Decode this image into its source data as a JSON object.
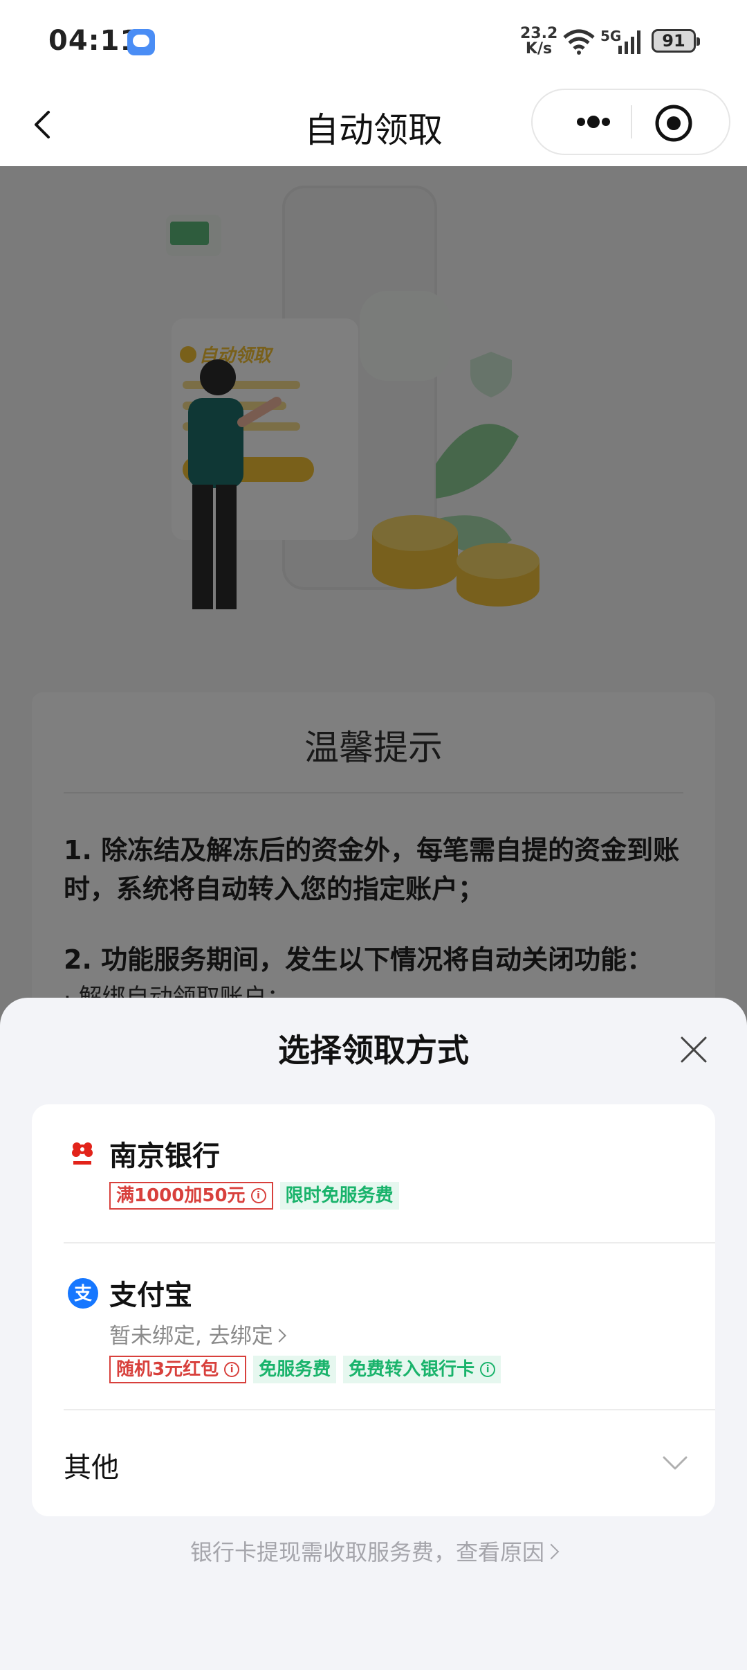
{
  "status_bar": {
    "time": "04:11",
    "net_speed_value": "23.2",
    "net_speed_unit": "K/s",
    "signal_label": "5G",
    "battery": "91"
  },
  "nav": {
    "title": "自动领取"
  },
  "hero": {
    "card_text": "自动领取"
  },
  "tips": {
    "title": "温馨提示",
    "item1": "1. 除冻结及解冻后的资金外，每笔需自提的资金到账时，系统将自动转入您的指定账户；",
    "item2": "2. 功能服务期间，发生以下情况将自动关闭功能：",
    "item2_sub": "· 解绑自动领取账户；"
  },
  "sheet": {
    "title": "选择领取方式",
    "options": [
      {
        "name": "南京银行",
        "tags": [
          "满1000加50元",
          "限时免服务费"
        ]
      },
      {
        "name": "支付宝",
        "subtitle": "暂未绑定, 去绑定",
        "tags": [
          "随机3元红包",
          "免服务费",
          "免费转入银行卡"
        ]
      }
    ],
    "other_label": "其他",
    "footer_note": "银行卡提现需收取服务费，查看原因"
  },
  "colors": {
    "accent_green": "#19b36b",
    "tag_red": "#d8403c",
    "alipay_blue": "#1677ff"
  }
}
